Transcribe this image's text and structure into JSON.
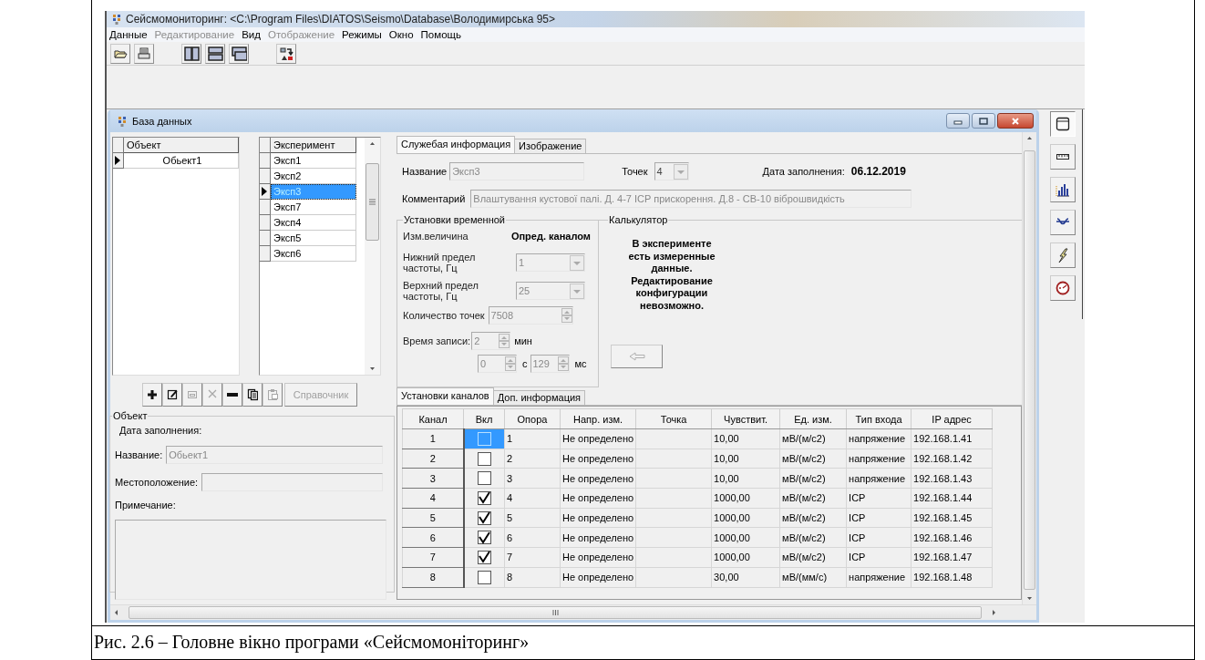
{
  "window": {
    "title": "Сейсмомониторинг: <C:\\Program Files\\DIATOS\\Seismo\\Database\\Володимирська 95>"
  },
  "menu": [
    {
      "label": "Данные",
      "disabled": false
    },
    {
      "label": "Редактирование",
      "disabled": true
    },
    {
      "label": "Вид",
      "disabled": false
    },
    {
      "label": "Отображение",
      "disabled": true
    },
    {
      "label": "Режимы",
      "disabled": false
    },
    {
      "label": "Окно",
      "disabled": false
    },
    {
      "label": "Помощь",
      "disabled": false
    }
  ],
  "side_toolbar": [
    {
      "selected": true
    },
    {
      "selected": false
    },
    {
      "selected": false
    },
    {
      "selected": false
    },
    {
      "selected": false
    },
    {
      "selected": false
    }
  ],
  "child_window": {
    "title": "База данных"
  },
  "objects_grid": {
    "column": "Объект",
    "rows": [
      {
        "name": "Обьект1",
        "selected": true
      }
    ]
  },
  "experiments_grid": {
    "column": "Эксперимент",
    "rows": [
      {
        "name": "Эксп1",
        "selected": false
      },
      {
        "name": "Эксп2",
        "selected": false
      },
      {
        "name": "Эксп3",
        "selected": true
      },
      {
        "name": "Эксп7",
        "selected": false
      },
      {
        "name": "Эксп4",
        "selected": false
      },
      {
        "name": "Эксп5",
        "selected": false
      },
      {
        "name": "Эксп6",
        "selected": false
      }
    ]
  },
  "record_buttons": [
    {
      "disabled": false
    },
    {
      "disabled": false
    },
    {
      "disabled": true
    },
    {
      "disabled": true
    },
    {
      "disabled": false
    },
    {
      "disabled": false
    },
    {
      "disabled": true
    }
  ],
  "reference_button": {
    "label": "Справочник",
    "disabled": true
  },
  "object_group": {
    "title": "Объект",
    "date_label": "Дата заполнения:",
    "name_label": "Название:",
    "name_value": "Обьект1",
    "location_label": "Местоположение:",
    "note_label": "Примечание:"
  },
  "info_tabs": [
    {
      "label": "Служебая информация",
      "selected": true
    },
    {
      "label": "Изображение",
      "selected": false
    }
  ],
  "info": {
    "name_label": "Название",
    "name_value": "Эксп3",
    "points_label": "Точек",
    "points_value": "4",
    "date_label": "Дата заполнения:",
    "date_value": "06.12.2019",
    "comment_label": "Комментарий",
    "comment_value": "Влаштування кустової палі. Д. 4-7 ICP прискорення. Д.8 - СВ-10 віброшвидкість"
  },
  "time_settings": {
    "title": "Установки временной",
    "quantity_label": "Изм.величина",
    "quantity_value": "Опред. каналом",
    "low_label": "Нижний предел частоты, Гц",
    "low_value": "1",
    "high_label": "Верхний предел частоты, Гц",
    "high_value": "25",
    "count_label": "Количество точек",
    "count_value": "7508",
    "time_label": "Время записи:",
    "minutes": "2",
    "minutes_unit": "мин",
    "seconds": "0",
    "seconds_unit": "с",
    "ms": "129",
    "ms_unit": "мс"
  },
  "calculator": {
    "title": "Калькулятор",
    "message": "В эксперименте есть измеренные данные. Редактирование конфигурации невозможно."
  },
  "channel_tabs": [
    {
      "label": "Установки каналов",
      "selected": true
    },
    {
      "label": "Доп. информация",
      "selected": false
    }
  ],
  "table": {
    "columns": [
      "Канал",
      "Вкл",
      "Опора",
      "Напр. изм.",
      "Точка",
      "Чувствит.",
      "Ед. изм.",
      "Тип входа",
      "IP адрес"
    ],
    "rows": [
      {
        "channel": "1",
        "on": false,
        "selected": true,
        "support": "1",
        "direction": "Не определено",
        "sensitivity": "10,00",
        "unit": "мВ/(м/с2)",
        "input": "напряжение",
        "ip": "192.168.1.41"
      },
      {
        "channel": "2",
        "on": false,
        "selected": false,
        "support": "2",
        "direction": "Не определено",
        "sensitivity": "10,00",
        "unit": "мВ/(м/с2)",
        "input": "напряжение",
        "ip": "192.168.1.42"
      },
      {
        "channel": "3",
        "on": false,
        "selected": false,
        "support": "3",
        "direction": "Не определено",
        "sensitivity": "10,00",
        "unit": "мВ/(м/с2)",
        "input": "напряжение",
        "ip": "192.168.1.43"
      },
      {
        "channel": "4",
        "on": true,
        "selected": false,
        "support": "4",
        "direction": "Не определено",
        "sensitivity": "1000,00",
        "unit": "мВ/(м/с2)",
        "input": "ICP",
        "ip": "192.168.1.44"
      },
      {
        "channel": "5",
        "on": true,
        "selected": false,
        "support": "5",
        "direction": "Не определено",
        "sensitivity": "1000,00",
        "unit": "мВ/(м/с2)",
        "input": "ICP",
        "ip": "192.168.1.45"
      },
      {
        "channel": "6",
        "on": true,
        "selected": false,
        "support": "6",
        "direction": "Не определено",
        "sensitivity": "1000,00",
        "unit": "мВ/(м/с2)",
        "input": "ICP",
        "ip": "192.168.1.46"
      },
      {
        "channel": "7",
        "on": true,
        "selected": false,
        "support": "7",
        "direction": "Не определено",
        "sensitivity": "1000,00",
        "unit": "мВ/(м/с2)",
        "input": "ICP",
        "ip": "192.168.1.47"
      },
      {
        "channel": "8",
        "on": false,
        "selected": false,
        "support": "8",
        "direction": "Не определено",
        "sensitivity": "30,00",
        "unit": "мВ/(мм/с)",
        "input": "напряжение",
        "ip": "192.168.1.48"
      }
    ]
  },
  "caption": "Рис. 2.6 – Головне вікно програми «Сейсмомоніторинг»"
}
